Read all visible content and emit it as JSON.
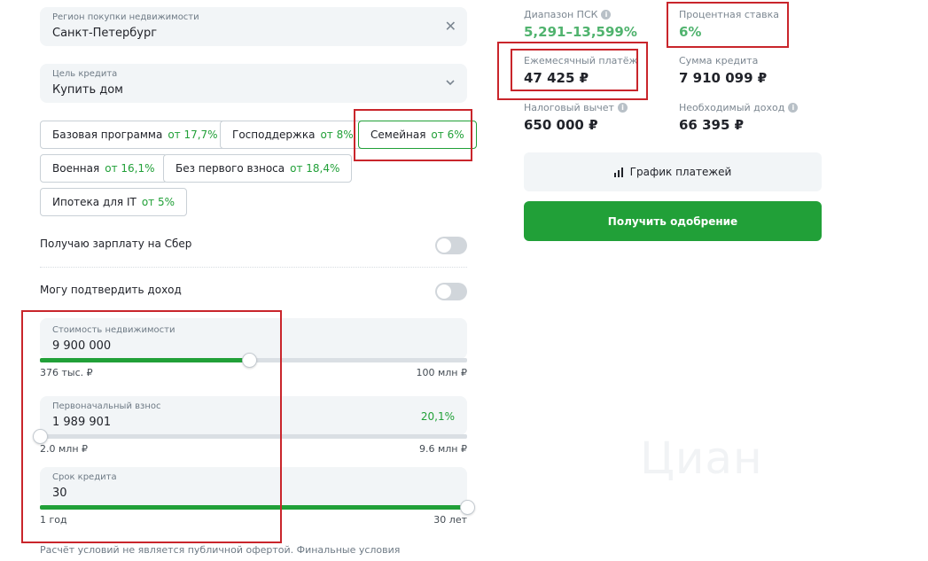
{
  "region": {
    "label": "Регион покупки недвижимости",
    "value": "Санкт-Петербург"
  },
  "purpose": {
    "label": "Цель кредита",
    "value": "Купить дом"
  },
  "programs": [
    {
      "name": "Базовая программа",
      "rate": "от 17,7%"
    },
    {
      "name": "Господдержка",
      "rate": "от 8%"
    },
    {
      "name": "Семейная",
      "rate": "от 6%",
      "selected": true
    },
    {
      "name": "Военная",
      "rate": "от 16,1%"
    },
    {
      "name": "Без первого взноса",
      "rate": "от 18,4%"
    },
    {
      "name": "Ипотека для IT",
      "rate": "от 5%"
    }
  ],
  "toggles": {
    "salary": {
      "label": "Получаю зарплату на Сбер",
      "on": false
    },
    "income": {
      "label": "Могу подтвердить доход",
      "on": false
    }
  },
  "property_cost": {
    "label": "Стоимость недвижимости",
    "value": "9 900 000",
    "min_label": "376 тыс. ₽",
    "max_label": "100 млн ₽",
    "fill_fraction": 0.49
  },
  "down_payment": {
    "label": "Первоначальный взнос",
    "value": "1 989 901",
    "percent": "20,1%",
    "min_label": "2.0 млн ₽",
    "max_label": "9.6 млн ₽",
    "fill_fraction": 0.0
  },
  "term": {
    "label": "Срок кредита",
    "value": "30",
    "min_label": "1 год",
    "max_label": "30 лет",
    "fill_fraction": 1.0
  },
  "disclaimer": "Расчёт условий не является публичной офертой. Финальные условия кредитования определяются при заключении договора.",
  "results": {
    "psk": {
      "label": "Диапазон ПСК",
      "value": "5,291–13,599%"
    },
    "rate": {
      "label": "Процентная ставка",
      "value": "6%"
    },
    "monthly": {
      "label": "Ежемесячный платёж",
      "value": "47 425 ₽"
    },
    "loan_sum": {
      "label": "Сумма кредита",
      "value": "7 910 099 ₽"
    },
    "tax": {
      "label": "Налоговый вычет",
      "value": "650 000 ₽"
    },
    "income": {
      "label": "Необходимый доход",
      "value": "66 395 ₽"
    }
  },
  "buttons": {
    "schedule": "График платежей",
    "approval": "Получить одобрение"
  },
  "watermark": "Циан",
  "colors": {
    "accent": "#21a038",
    "highlight": "#c9252b"
  }
}
